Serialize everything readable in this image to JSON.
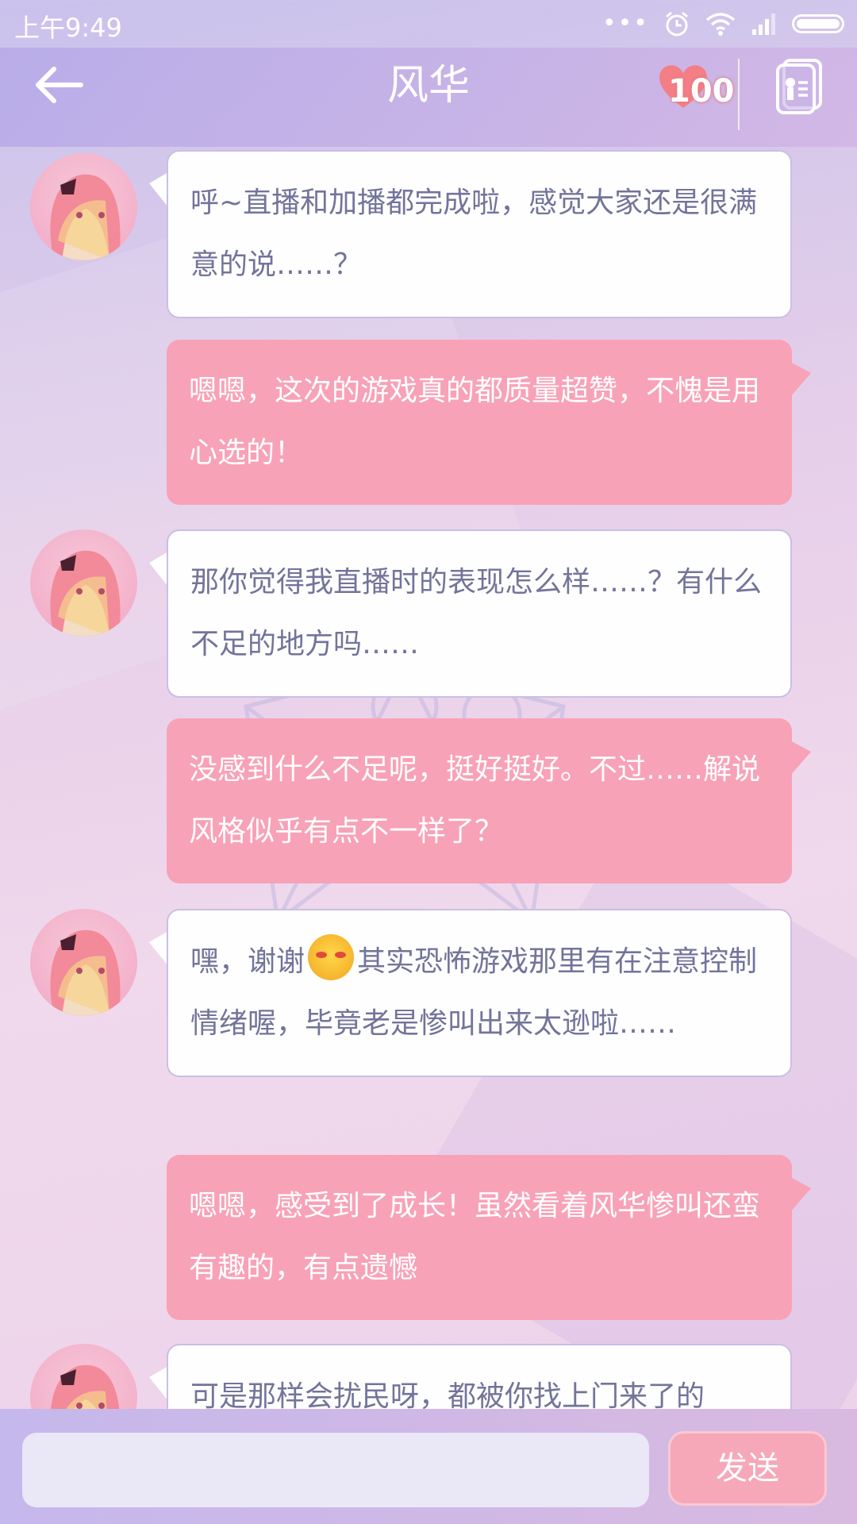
{
  "status_bar": {
    "time": "上午9:49",
    "icons": [
      "dots-icon",
      "alarm-icon",
      "wifi-icon",
      "signal-icon",
      "battery-icon"
    ]
  },
  "header": {
    "title": "风华",
    "affection_value": "100",
    "back_icon": "back-arrow-icon",
    "profile_icon": "profile-card-icon"
  },
  "colors": {
    "incoming_bubble": "#fefefe",
    "incoming_text": "#72749a",
    "outgoing_bubble": "#f8a2b7",
    "outgoing_text": "#ffffff",
    "send_button": "#f6a8b8"
  },
  "messages": [
    {
      "from": "风华",
      "text": "呼~直播和加播都完成啦，感觉大家还是很满意的说……？"
    },
    {
      "from": "me",
      "text": "嗯嗯，这次的游戏真的都质量超赞，不愧是用心选的！"
    },
    {
      "from": "风华",
      "text": "那你觉得我直播时的表现怎么样……？有什么不足的地方吗……"
    },
    {
      "from": "me",
      "text": "没感到什么不足呢，挺好挺好。不过……解说风格似乎有点不一样了？"
    },
    {
      "from": "风华",
      "text_before_emoji": "嘿，谢谢",
      "emoji": "blushing-face-emoji",
      "text_after_emoji": "其实恐怖游戏那里有在注意控制情绪喔，毕竟老是惨叫出来太逊啦……"
    },
    {
      "from": "me",
      "text": "嗯嗯，感受到了成长！虽然看着风华惨叫还蛮有趣的，有点遗憾"
    },
    {
      "from": "风华",
      "text": "可是那样会扰民呀，都被你找上门来了的"
    }
  ],
  "input": {
    "value": "",
    "send_label": "发送"
  }
}
